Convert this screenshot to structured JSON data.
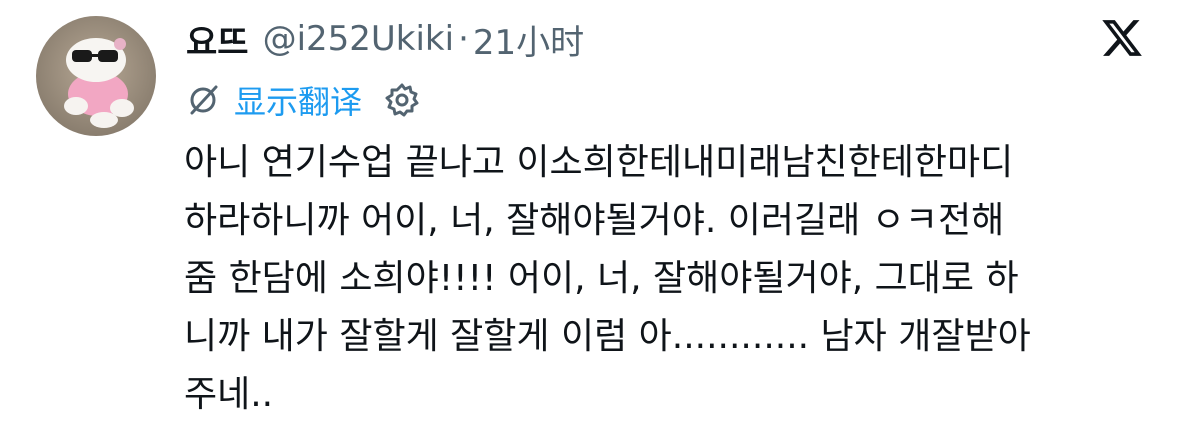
{
  "author": {
    "display_name": "요뜨",
    "handle": "@i252Ukiki",
    "separator": "·",
    "time": "21小时"
  },
  "translate": {
    "label": "显示翻译"
  },
  "icons": {
    "brand": "x-logo-icon",
    "translate": "translate-icon",
    "settings": "gear-icon"
  },
  "tweet": {
    "lines": [
      "아니 연기수업 끝나고 이소희한테내미래남친한테한마디",
      "하라하니까 어이, 너, 잘해야될거야. 이러길래 ㅇㅋ전해",
      "줌 한담에 소희야!!!! 어이, 너, 잘해야될거야, 그대로 하",
      "니까 내가 잘할게 잘할게 이럼 아............ 남자 개잘받아",
      "주네.."
    ]
  },
  "colors": {
    "text": "#0f1419",
    "secondary": "#536471",
    "link": "#1d9bf0"
  }
}
